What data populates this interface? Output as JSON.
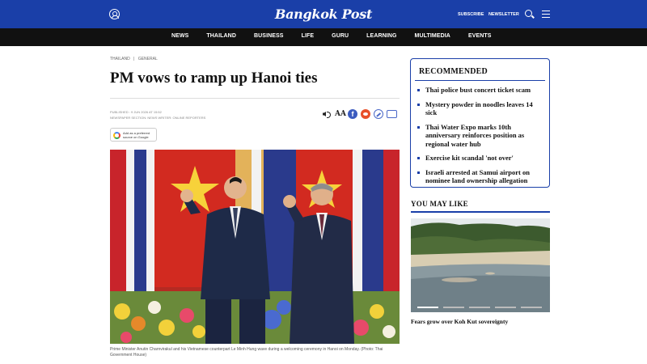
{
  "header": {
    "logo": "Bangkok Post",
    "subscribe": "SUBSCRIBE",
    "newsletter": "NEWSLETTER",
    "icons": [
      "user-icon",
      "search-icon",
      "menu-icon"
    ]
  },
  "nav": {
    "items": [
      "NEWS",
      "THAILAND",
      "BUSINESS",
      "LIFE",
      "GURU",
      "LEARNING",
      "MULTIMEDIA",
      "EVENTS"
    ]
  },
  "article": {
    "breadcrumb": [
      "THAILAND",
      "GENERAL"
    ],
    "breadcrumb_sep": "|",
    "headline": "PM vows to ramp up Hanoi ties",
    "published": "PUBLISHED : 9 JUN 2026 AT 15:52",
    "section": "NEWSPAPER SECTION: NEWS     WRITER: ONLINE REPORTERS",
    "google_badge": [
      "Add as a preferred",
      "source on Google"
    ],
    "share_icons": [
      "audio-icon",
      "font-size-icon",
      "facebook-icon",
      "reddit-icon",
      "link-icon",
      "comment-icon"
    ],
    "caption": "Prime Minister Anutin Charnvirakul and his Vietnamese counterpart Le Minh Hung wave during a welcoming ceremony in Hanoi on Monday. (Photo: Thai Government House)"
  },
  "recommended": {
    "title": "RECOMMENDED",
    "items": [
      "Thai police bust concert ticket scam",
      "Mystery powder in noodles leaves 14 sick",
      "Thai Water Expo marks 10th anniversary reinforces position as regional water hub",
      "Exercise kit scandal 'not over'",
      "Israeli arrested at Samui airport on nominee land ownership allegation"
    ]
  },
  "you_may_like": {
    "title": "YOU MAY LIKE",
    "caption": "Fears grow over Koh Kut sovereignty"
  },
  "colors": {
    "brand_blue": "#1a3fa8",
    "nav_black": "#111111"
  }
}
